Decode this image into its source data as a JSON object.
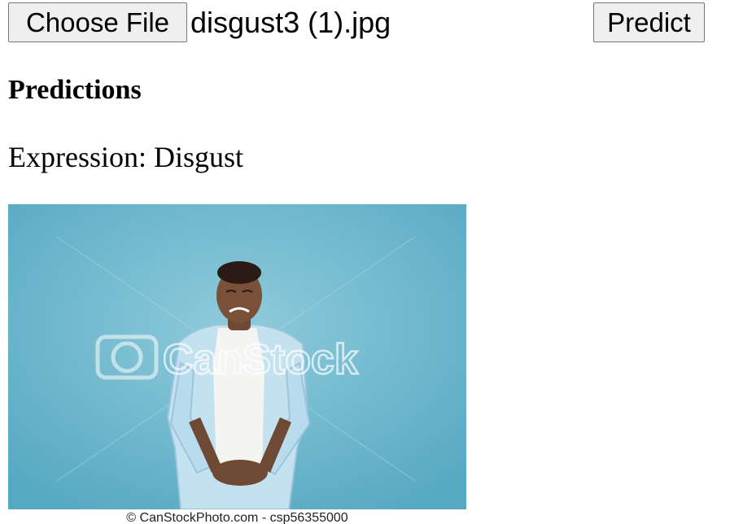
{
  "form": {
    "choose_file_label": "Choose File",
    "file_name": "disgust3 (1).jpg",
    "predict_label": "Predict"
  },
  "predictions": {
    "heading": "Predictions",
    "expression_text": "Expression: Disgust"
  },
  "image": {
    "watermark": "CanStock",
    "credit": "© CanStockPhoto.com - csp56355000",
    "background_color": "#6cb5cc"
  }
}
